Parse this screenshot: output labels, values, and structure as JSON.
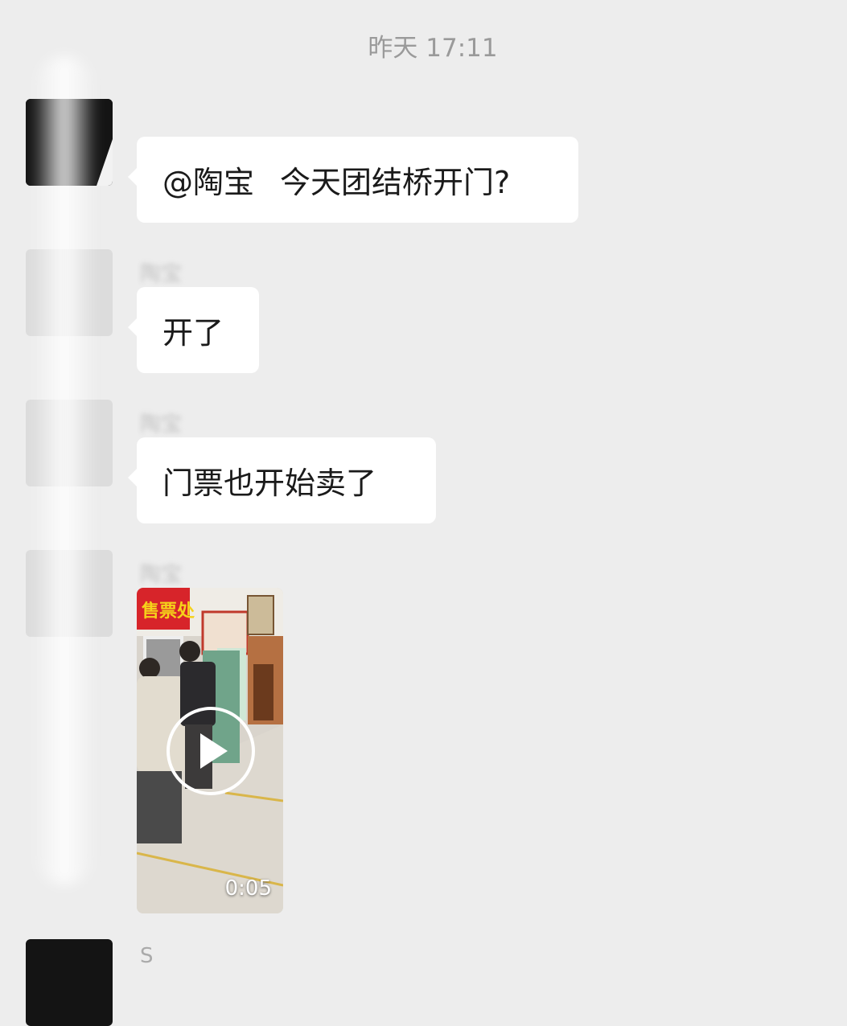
{
  "chat": {
    "timestamp": "昨天 17:11",
    "messages": [
      {
        "sender": "",
        "mention": "@陶宝",
        "text": "今天团结桥开门?"
      },
      {
        "sender": "陶宝",
        "text": "开了"
      },
      {
        "sender": "陶宝",
        "text": "门票也开始卖了"
      },
      {
        "sender": "陶宝",
        "video": {
          "duration": "0:05",
          "sign_text": "售票处"
        }
      },
      {
        "sender": "S"
      }
    ]
  },
  "colors": {
    "background": "#ededed",
    "bubble": "#ffffff",
    "text": "#1a1a1a",
    "timestamp": "#9a9a9a"
  }
}
